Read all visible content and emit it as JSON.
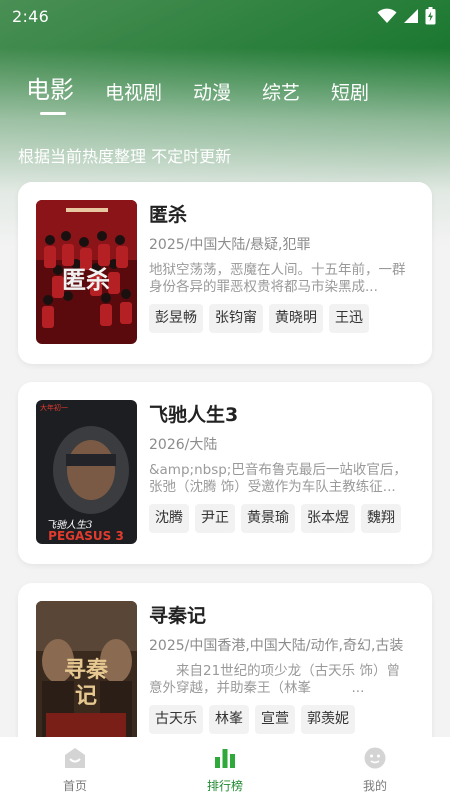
{
  "status": {
    "time": "2:46"
  },
  "tabs": [
    {
      "label": "电影",
      "active": true
    },
    {
      "label": "电视剧",
      "active": false
    },
    {
      "label": "动漫",
      "active": false
    },
    {
      "label": "综艺",
      "active": false
    },
    {
      "label": "短剧",
      "active": false
    }
  ],
  "subtitle": "根据当前热度整理 不定时更新",
  "movies": [
    {
      "title": "匿杀",
      "meta": "2025/中国大陆/悬疑,犯罪",
      "desc": "地狱空荡荡，恶魔在人间。十五年前，一群身份各异的罪恶权贵将都马市染黑成...",
      "tags": [
        "彭昱畅",
        "张钧甯",
        "黄晓明",
        "王迅"
      ]
    },
    {
      "title": "飞驰人生3",
      "meta": "2026/大陆",
      "desc": "&amp;nbsp;巴音布鲁克最后一站收官后，张弛（沈腾 饰）受邀作为车队主教练征...",
      "tags": [
        "沈腾",
        "尹正",
        "黄景瑜",
        "张本煜",
        "魏翔"
      ]
    },
    {
      "title": "寻秦记",
      "meta": "2025/中国香港,中国大陆/动作,奇幻,古装",
      "desc": "　　来自21世纪的项少龙（古天乐 饰）曾意外穿越，并助秦王（林峯　　　...",
      "tags": [
        "古天乐",
        "林峯",
        "宣萱",
        "郭羡妮"
      ]
    }
  ],
  "nav": [
    {
      "label": "首页",
      "active": false,
      "icon": "home-icon"
    },
    {
      "label": "排行榜",
      "active": true,
      "icon": "ranking-icon"
    },
    {
      "label": "我的",
      "active": false,
      "icon": "profile-icon"
    }
  ],
  "colors": {
    "accent": "#1f8a2f",
    "header_green": "#0b6b1f"
  }
}
